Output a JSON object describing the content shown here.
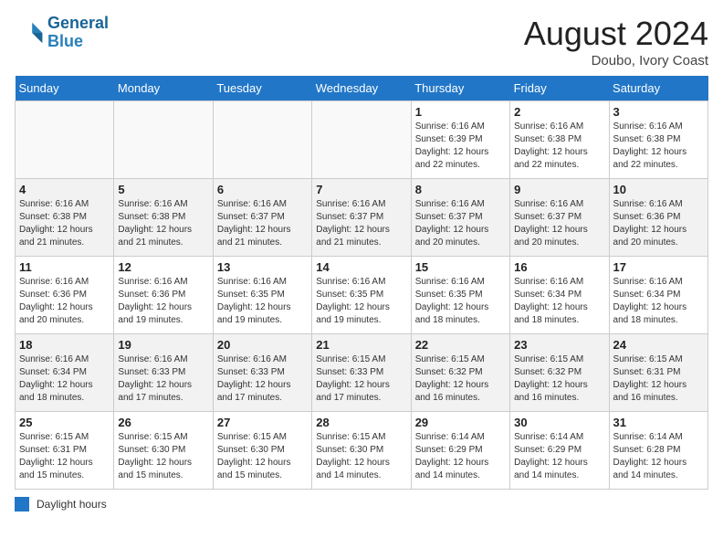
{
  "header": {
    "logo_line1": "General",
    "logo_line2": "Blue",
    "month": "August 2024",
    "location": "Doubo, Ivory Coast"
  },
  "days_of_week": [
    "Sunday",
    "Monday",
    "Tuesday",
    "Wednesday",
    "Thursday",
    "Friday",
    "Saturday"
  ],
  "weeks": [
    [
      {
        "day": "",
        "info": ""
      },
      {
        "day": "",
        "info": ""
      },
      {
        "day": "",
        "info": ""
      },
      {
        "day": "",
        "info": ""
      },
      {
        "day": "1",
        "info": "Sunrise: 6:16 AM\nSunset: 6:39 PM\nDaylight: 12 hours and 22 minutes."
      },
      {
        "day": "2",
        "info": "Sunrise: 6:16 AM\nSunset: 6:38 PM\nDaylight: 12 hours and 22 minutes."
      },
      {
        "day": "3",
        "info": "Sunrise: 6:16 AM\nSunset: 6:38 PM\nDaylight: 12 hours and 22 minutes."
      }
    ],
    [
      {
        "day": "4",
        "info": "Sunrise: 6:16 AM\nSunset: 6:38 PM\nDaylight: 12 hours and 21 minutes."
      },
      {
        "day": "5",
        "info": "Sunrise: 6:16 AM\nSunset: 6:38 PM\nDaylight: 12 hours and 21 minutes."
      },
      {
        "day": "6",
        "info": "Sunrise: 6:16 AM\nSunset: 6:37 PM\nDaylight: 12 hours and 21 minutes."
      },
      {
        "day": "7",
        "info": "Sunrise: 6:16 AM\nSunset: 6:37 PM\nDaylight: 12 hours and 21 minutes."
      },
      {
        "day": "8",
        "info": "Sunrise: 6:16 AM\nSunset: 6:37 PM\nDaylight: 12 hours and 20 minutes."
      },
      {
        "day": "9",
        "info": "Sunrise: 6:16 AM\nSunset: 6:37 PM\nDaylight: 12 hours and 20 minutes."
      },
      {
        "day": "10",
        "info": "Sunrise: 6:16 AM\nSunset: 6:36 PM\nDaylight: 12 hours and 20 minutes."
      }
    ],
    [
      {
        "day": "11",
        "info": "Sunrise: 6:16 AM\nSunset: 6:36 PM\nDaylight: 12 hours and 20 minutes."
      },
      {
        "day": "12",
        "info": "Sunrise: 6:16 AM\nSunset: 6:36 PM\nDaylight: 12 hours and 19 minutes."
      },
      {
        "day": "13",
        "info": "Sunrise: 6:16 AM\nSunset: 6:35 PM\nDaylight: 12 hours and 19 minutes."
      },
      {
        "day": "14",
        "info": "Sunrise: 6:16 AM\nSunset: 6:35 PM\nDaylight: 12 hours and 19 minutes."
      },
      {
        "day": "15",
        "info": "Sunrise: 6:16 AM\nSunset: 6:35 PM\nDaylight: 12 hours and 18 minutes."
      },
      {
        "day": "16",
        "info": "Sunrise: 6:16 AM\nSunset: 6:34 PM\nDaylight: 12 hours and 18 minutes."
      },
      {
        "day": "17",
        "info": "Sunrise: 6:16 AM\nSunset: 6:34 PM\nDaylight: 12 hours and 18 minutes."
      }
    ],
    [
      {
        "day": "18",
        "info": "Sunrise: 6:16 AM\nSunset: 6:34 PM\nDaylight: 12 hours and 18 minutes."
      },
      {
        "day": "19",
        "info": "Sunrise: 6:16 AM\nSunset: 6:33 PM\nDaylight: 12 hours and 17 minutes."
      },
      {
        "day": "20",
        "info": "Sunrise: 6:16 AM\nSunset: 6:33 PM\nDaylight: 12 hours and 17 minutes."
      },
      {
        "day": "21",
        "info": "Sunrise: 6:15 AM\nSunset: 6:33 PM\nDaylight: 12 hours and 17 minutes."
      },
      {
        "day": "22",
        "info": "Sunrise: 6:15 AM\nSunset: 6:32 PM\nDaylight: 12 hours and 16 minutes."
      },
      {
        "day": "23",
        "info": "Sunrise: 6:15 AM\nSunset: 6:32 PM\nDaylight: 12 hours and 16 minutes."
      },
      {
        "day": "24",
        "info": "Sunrise: 6:15 AM\nSunset: 6:31 PM\nDaylight: 12 hours and 16 minutes."
      }
    ],
    [
      {
        "day": "25",
        "info": "Sunrise: 6:15 AM\nSunset: 6:31 PM\nDaylight: 12 hours and 15 minutes."
      },
      {
        "day": "26",
        "info": "Sunrise: 6:15 AM\nSunset: 6:30 PM\nDaylight: 12 hours and 15 minutes."
      },
      {
        "day": "27",
        "info": "Sunrise: 6:15 AM\nSunset: 6:30 PM\nDaylight: 12 hours and 15 minutes."
      },
      {
        "day": "28",
        "info": "Sunrise: 6:15 AM\nSunset: 6:30 PM\nDaylight: 12 hours and 14 minutes."
      },
      {
        "day": "29",
        "info": "Sunrise: 6:14 AM\nSunset: 6:29 PM\nDaylight: 12 hours and 14 minutes."
      },
      {
        "day": "30",
        "info": "Sunrise: 6:14 AM\nSunset: 6:29 PM\nDaylight: 12 hours and 14 minutes."
      },
      {
        "day": "31",
        "info": "Sunrise: 6:14 AM\nSunset: 6:28 PM\nDaylight: 12 hours and 14 minutes."
      }
    ]
  ],
  "footer": {
    "daylight_label": "Daylight hours"
  }
}
